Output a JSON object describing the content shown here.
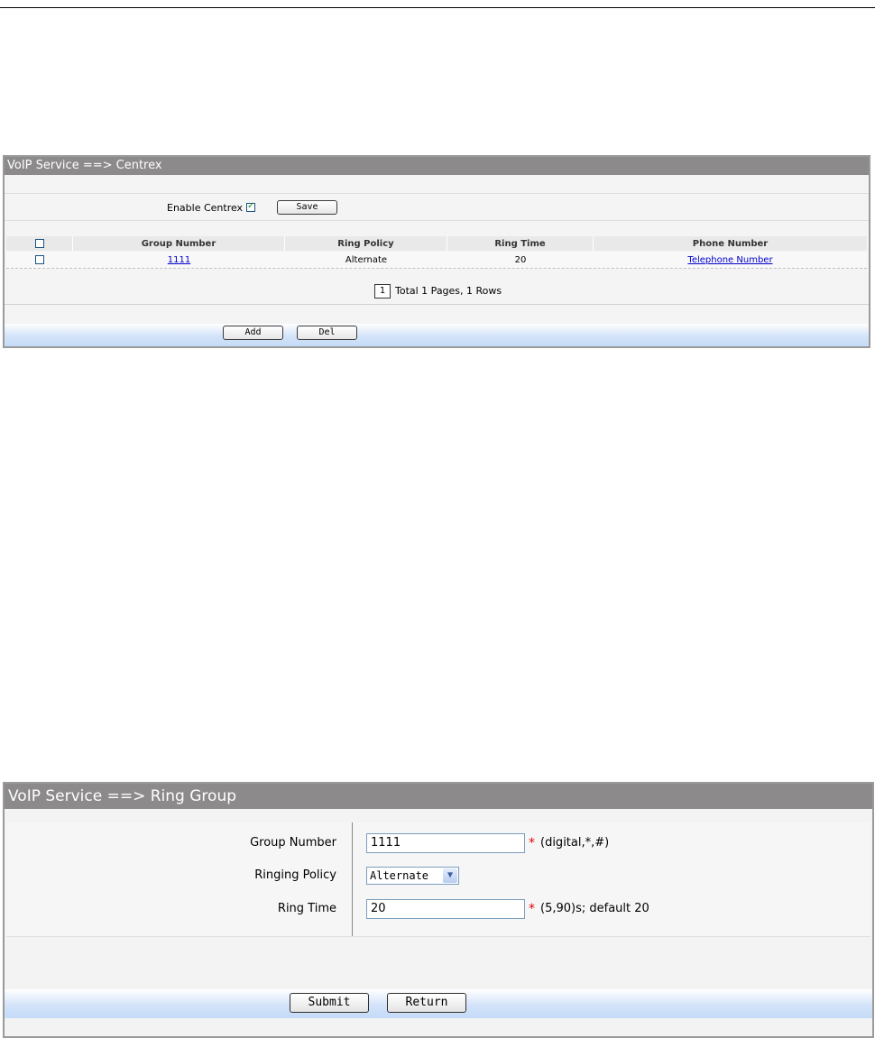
{
  "centrex": {
    "title": "VoIP Service ==> Centrex",
    "enable_label": "Enable Centrex",
    "save_label": "Save",
    "columns": [
      "Group Number",
      "Ring Policy",
      "Ring Time",
      "Phone Number"
    ],
    "rows": [
      {
        "group_number": "1111",
        "ring_policy": "Alternate",
        "ring_time": "20",
        "phone_number": "Telephone Number"
      }
    ],
    "pager": {
      "page": "1",
      "summary": "Total 1 Pages, 1 Rows"
    },
    "add_label": "Add",
    "del_label": "Del"
  },
  "ring_group": {
    "title": "VoIP Service ==> Ring Group",
    "group_number_label": "Group Number",
    "group_number_value": "1111",
    "group_number_hint": "(digital,*,#)",
    "ringing_policy_label": "Ringing Policy",
    "ringing_policy_value": "Alternate",
    "ring_time_label": "Ring Time",
    "ring_time_value": "20",
    "ring_time_hint": "(5,90)s; default 20",
    "required_mark": "*",
    "submit_label": "Submit",
    "return_label": "Return"
  }
}
